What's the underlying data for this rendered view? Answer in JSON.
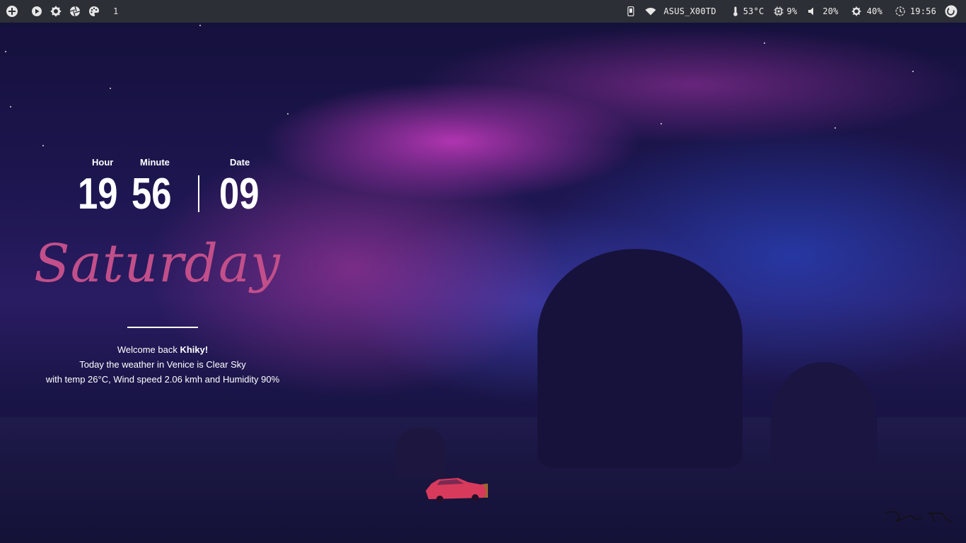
{
  "topbar": {
    "left_icons": [
      "plus-circle-icon",
      "play-icon",
      "gear-icon",
      "aperture-icon",
      "palette-icon"
    ],
    "workspace": "1",
    "network": {
      "icon": "wifi-icon",
      "label": "ASUS_X00TD"
    },
    "temperature": {
      "icon": "thermometer-icon",
      "value": "53°C"
    },
    "cpu": {
      "icon": "cpu-icon",
      "value": "9%"
    },
    "volume": {
      "icon": "speaker-icon",
      "value": "20%"
    },
    "brightness": {
      "icon": "brightness-icon",
      "value": "40%"
    },
    "clock": {
      "icon": "clock-icon",
      "value": "19:56"
    },
    "power_icon": "power-icon",
    "phone_icon": "phone-icon"
  },
  "clock_widget": {
    "hour_label": "Hour",
    "minute_label": "Minute",
    "date_label": "Date",
    "hour": "19",
    "minute": "56",
    "date": "09"
  },
  "day": "Saturday",
  "welcome": {
    "greeting": "Welcome back ",
    "user": "Khiky!",
    "line2": "Today the weather in Venice is Clear Sky",
    "line3": "with temp 26°C, Wind speed 2.06 kmh and Humidity 90%"
  },
  "colors": {
    "topbar_bg": "#2c2f35",
    "day_text": "#c24f8a"
  }
}
